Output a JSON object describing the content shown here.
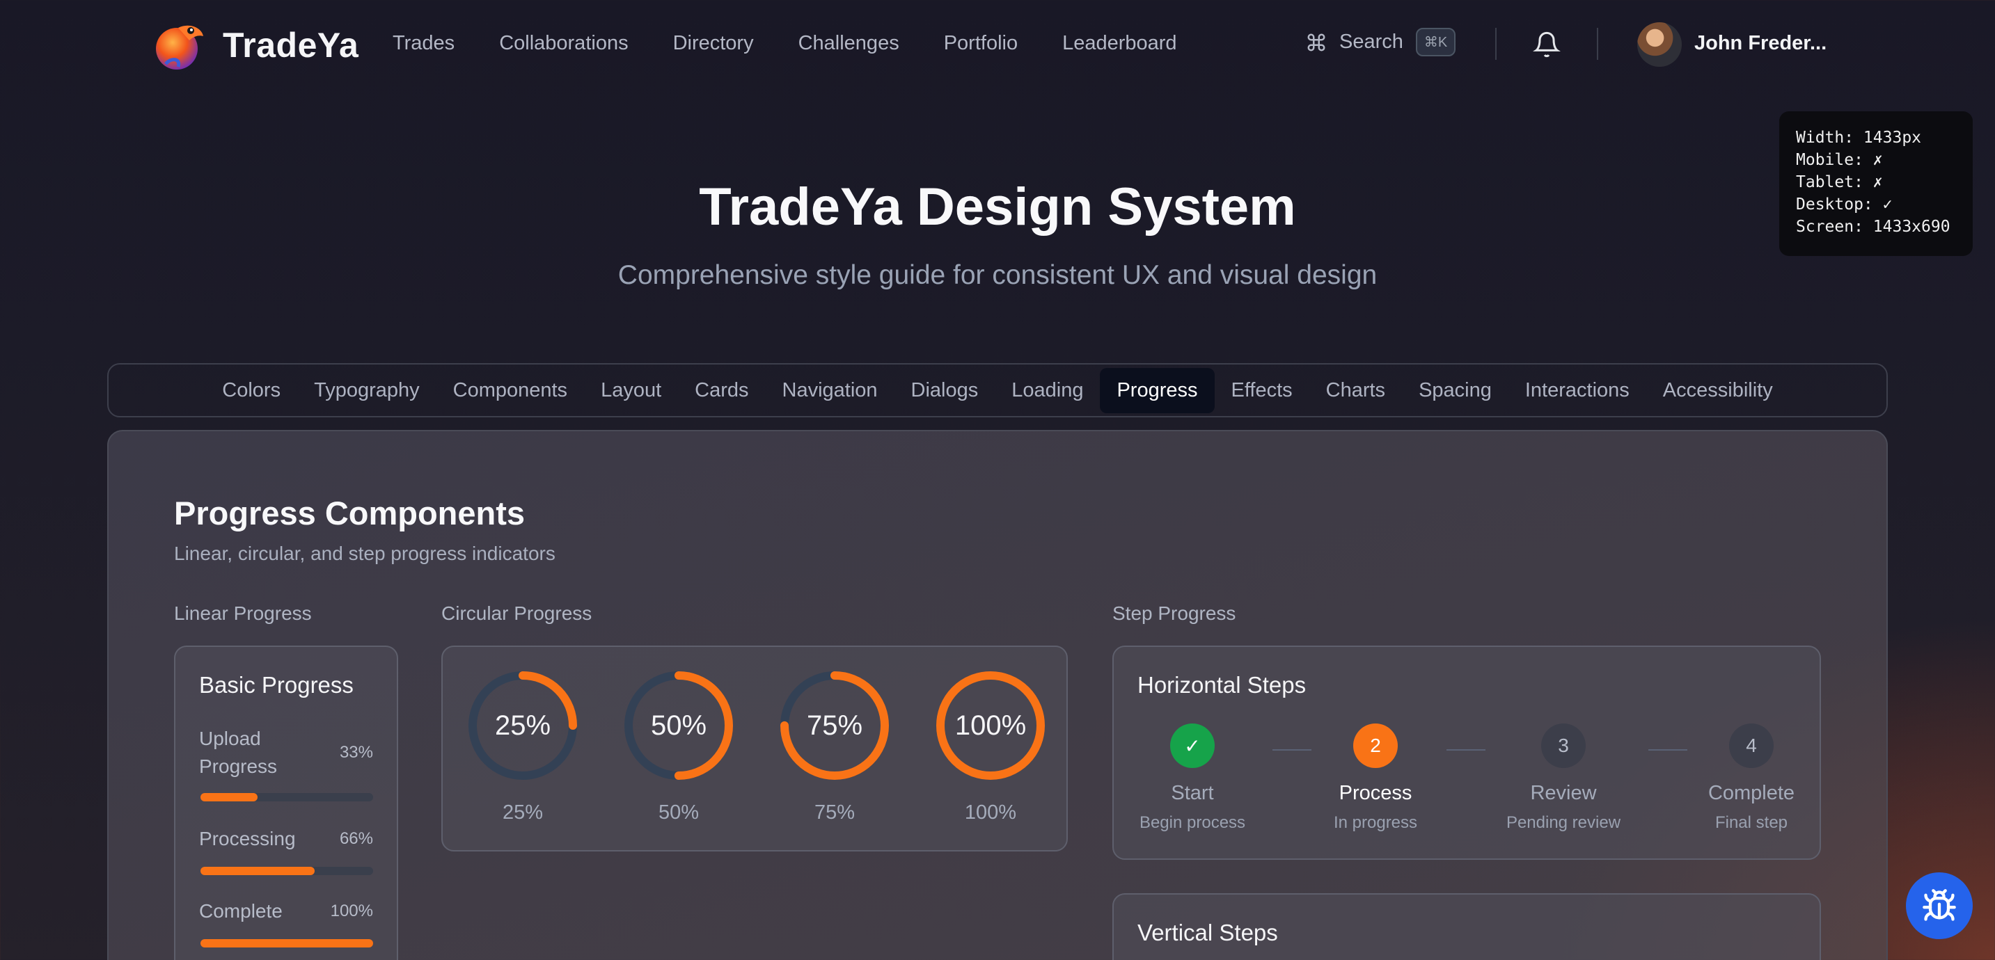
{
  "header": {
    "brand": "TradeYa",
    "nav": [
      "Trades",
      "Collaborations",
      "Directory",
      "Challenges",
      "Portfolio",
      "Leaderboard"
    ],
    "search_label": "Search",
    "search_shortcut": "⌘K",
    "user_name": "John Freder..."
  },
  "dev_info": [
    "Width: 1433px",
    "Mobile: ✗",
    "Tablet: ✗",
    "Desktop: ✓",
    "Screen: 1433x690"
  ],
  "hero": {
    "title": "TradeYa Design System",
    "subtitle": "Comprehensive style guide for consistent UX and visual design"
  },
  "tabs": [
    "Colors",
    "Typography",
    "Components",
    "Layout",
    "Cards",
    "Navigation",
    "Dialogs",
    "Loading",
    "Progress",
    "Effects",
    "Charts",
    "Spacing",
    "Interactions",
    "Accessibility"
  ],
  "active_tab": "Progress",
  "section": {
    "title": "Progress Components",
    "subtitle": "Linear, circular, and step progress indicators"
  },
  "linear": {
    "label": "Linear Progress",
    "card_title": "Basic Progress",
    "items": [
      {
        "label": "Upload Progress",
        "pct_text": "33%",
        "value": 0.33
      },
      {
        "label": "Processing",
        "pct_text": "66%",
        "value": 0.66
      },
      {
        "label": "Complete",
        "pct_text": "100%",
        "value": 1.0
      }
    ]
  },
  "circular": {
    "label": "Circular Progress",
    "items": [
      {
        "center": "25%",
        "caption": "25%",
        "value": 0.25
      },
      {
        "center": "50%",
        "caption": "50%",
        "value": 0.5
      },
      {
        "center": "75%",
        "caption": "75%",
        "value": 0.75
      },
      {
        "center": "100%",
        "caption": "100%",
        "value": 1.0
      }
    ]
  },
  "steps": {
    "label": "Step Progress",
    "horizontal_title": "Horizontal Steps",
    "vertical_title": "Vertical Steps",
    "items": [
      {
        "marker": "✓",
        "name": "Start",
        "desc": "Begin process",
        "state": "done"
      },
      {
        "marker": "2",
        "name": "Process",
        "desc": "In progress",
        "state": "current"
      },
      {
        "marker": "3",
        "name": "Review",
        "desc": "Pending review",
        "state": "pending"
      },
      {
        "marker": "4",
        "name": "Complete",
        "desc": "Final step",
        "state": "pending"
      }
    ]
  },
  "colors": {
    "accent": "#f97316",
    "success": "#16a34a",
    "track": "#334155",
    "fab": "#2563eb"
  }
}
